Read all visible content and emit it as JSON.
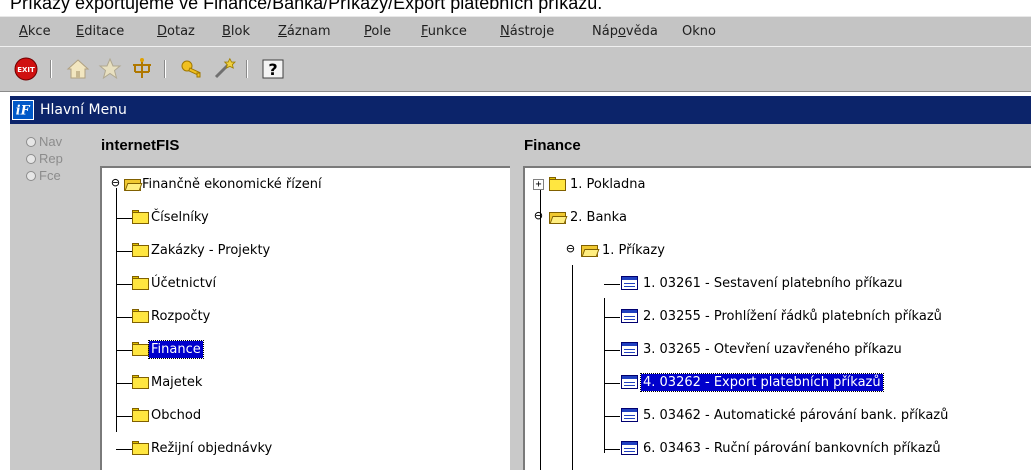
{
  "caption": "Příkazy exportujeme ve Finance/Banka/Příkazy/Export platebních příkazů.",
  "menu": {
    "items": [
      {
        "pre": "",
        "ul": "A",
        "post": "kce"
      },
      {
        "pre": "",
        "ul": "E",
        "post": "ditace"
      },
      {
        "pre": "",
        "ul": "D",
        "post": "otaz"
      },
      {
        "pre": "",
        "ul": "B",
        "post": "lok"
      },
      {
        "pre": "",
        "ul": "Z",
        "post": "áznam"
      },
      {
        "pre": "",
        "ul": "P",
        "post": "ole"
      },
      {
        "pre": "",
        "ul": "F",
        "post": "unkce"
      },
      {
        "pre": "",
        "ul": "N",
        "post": "ástroje"
      },
      {
        "pre": "Náp",
        "ul": "o",
        "post": "věda"
      },
      {
        "pre": "Okno",
        "ul": "",
        "post": ""
      }
    ]
  },
  "toolbar": {
    "exit_label": "EXIT",
    "help_label": "?",
    "icons": [
      "exit-icon",
      "home-icon",
      "star-icon",
      "tree-icon",
      "key-icon",
      "wand-icon",
      "help-icon"
    ]
  },
  "window": {
    "title": "Hlavní Menu"
  },
  "nav_options": [
    {
      "label": "Nav"
    },
    {
      "label": "Rep"
    },
    {
      "label": "Fce"
    }
  ],
  "left_panel": {
    "title": "internetFIS",
    "root": "Finančně ekonomické řízení",
    "items": [
      {
        "label": "Číselníky",
        "selected": false
      },
      {
        "label": "Zakázky - Projekty",
        "selected": false
      },
      {
        "label": "Účetnictví",
        "selected": false
      },
      {
        "label": "Rozpočty",
        "selected": false
      },
      {
        "label": "Finance",
        "selected": true
      },
      {
        "label": "Majetek",
        "selected": false
      },
      {
        "label": "Obchod",
        "selected": false
      },
      {
        "label": "Režijní objednávky",
        "selected": false
      }
    ]
  },
  "right_panel": {
    "title": "Finance",
    "pokladna": "1. Pokladna",
    "banka": "2. Banka",
    "prikazy": "1. Příkazy",
    "forms": [
      {
        "label": "1. 03261 - Sestavení platebního příkazu",
        "selected": false
      },
      {
        "label": "2. 03255 - Prohlížení řádků platebních příkazů",
        "selected": false
      },
      {
        "label": "3. 03265 - Otevření uzavřeného příkazu",
        "selected": false
      },
      {
        "label": "4. 03262 - Export platebních příkazů",
        "selected": true
      },
      {
        "label": "5. 03462 - Automatické párování bank. příkazů",
        "selected": false
      },
      {
        "label": "6. 03463 - Ruční párování bankovních příkazů",
        "selected": false
      }
    ]
  },
  "colors": {
    "titlebar": "#0c246a",
    "selection": "#0000cc",
    "chrome": "#c4c4c4",
    "folder": "#ffe640"
  }
}
